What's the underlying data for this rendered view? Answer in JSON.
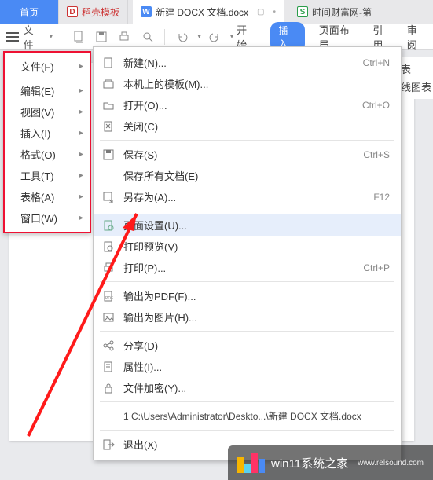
{
  "tabs": {
    "home": "首页",
    "template": "稻壳模板",
    "doc": "新建 DOCX 文档.docx",
    "right": "时间财富网-第"
  },
  "toolbar": {
    "file_label": "文件"
  },
  "ribbon": {
    "start": "开始",
    "insert": "插入",
    "layout": "页面布局",
    "reference": "引用",
    "review": "审阅"
  },
  "right_hints": {
    "l1": "表",
    "l2": "线图表"
  },
  "menu1": {
    "file": "文件(F)",
    "edit": "编辑(E)",
    "view": "视图(V)",
    "insert": "插入(I)",
    "format": "格式(O)",
    "tool": "工具(T)",
    "table": "表格(A)",
    "window": "窗口(W)"
  },
  "menu2": {
    "new": {
      "label": "新建(N)...",
      "shortcut": "Ctrl+N"
    },
    "template": {
      "label": "本机上的模板(M)...",
      "shortcut": ""
    },
    "open": {
      "label": "打开(O)...",
      "shortcut": "Ctrl+O"
    },
    "close": {
      "label": "关闭(C)",
      "shortcut": ""
    },
    "save": {
      "label": "保存(S)",
      "shortcut": "Ctrl+S"
    },
    "saveall": {
      "label": "保存所有文档(E)",
      "shortcut": ""
    },
    "saveas": {
      "label": "另存为(A)...",
      "shortcut": "F12"
    },
    "pagesetup": {
      "label": "页面设置(U)...",
      "shortcut": ""
    },
    "preview": {
      "label": "打印预览(V)",
      "shortcut": ""
    },
    "print": {
      "label": "打印(P)...",
      "shortcut": "Ctrl+P"
    },
    "exportpdf": {
      "label": "输出为PDF(F)...",
      "shortcut": ""
    },
    "exportimg": {
      "label": "输出为图片(H)...",
      "shortcut": ""
    },
    "share": {
      "label": "分享(D)",
      "shortcut": ""
    },
    "props": {
      "label": "属性(I)...",
      "shortcut": ""
    },
    "encrypt": {
      "label": "文件加密(Y)...",
      "shortcut": ""
    },
    "recent": {
      "label": "1 C:\\Users\\Administrator\\Deskto...\\新建 DOCX 文档.docx",
      "shortcut": ""
    },
    "exit": {
      "label": "退出(X)",
      "shortcut": ""
    }
  },
  "watermark": {
    "title": "win11系统之家",
    "sub": "www.relsound.com"
  }
}
